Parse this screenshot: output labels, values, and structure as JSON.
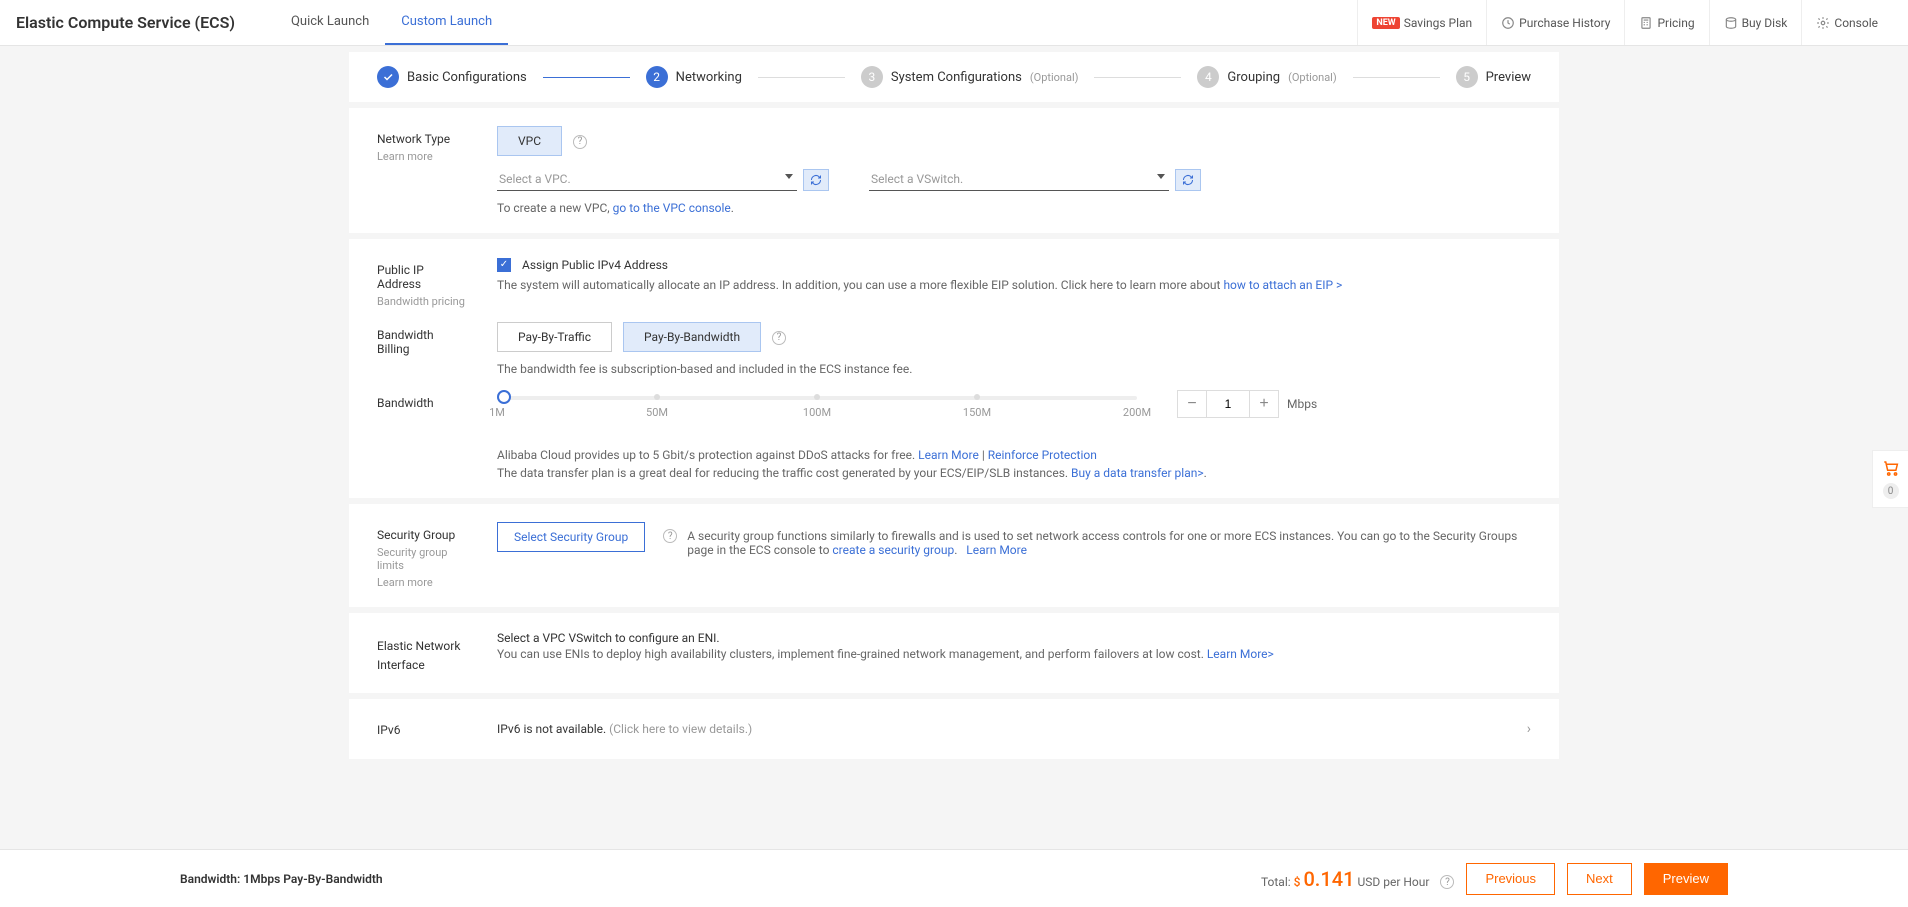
{
  "header": {
    "title": "Elastic Compute Service (ECS)",
    "tabs": {
      "quick": "Quick Launch",
      "custom": "Custom Launch"
    },
    "actions": {
      "new_badge": "NEW",
      "savings": "Savings Plan",
      "history": "Purchase History",
      "pricing": "Pricing",
      "buydisk": "Buy Disk",
      "console": "Console"
    }
  },
  "steps": {
    "s1": "Basic Configurations",
    "s2": "Networking",
    "s3": "System Configurations",
    "s4": "Grouping",
    "s5": "Preview",
    "optional": "(Optional)"
  },
  "network": {
    "label": "Network Type",
    "learn_more": "Learn more",
    "vpc_btn": "VPC",
    "select_vpc_ph": "Select a VPC.",
    "select_vswitch_ph": "Select a VSwitch.",
    "create_note_pre": "To create a new VPC, ",
    "create_note_link": "go to the VPC console"
  },
  "public_ip": {
    "label": "Public IP Address",
    "hint": "Bandwidth pricing",
    "checkbox_label": "Assign Public IPv4 Address",
    "desc_pre": "The system will automatically allocate an IP address. In addition, you can use a more flexible EIP solution. Click here to learn more about ",
    "desc_link": "how to attach an EIP >"
  },
  "billing": {
    "label": "Bandwidth Billing",
    "opt_traffic": "Pay-By-Traffic",
    "opt_bandwidth": "Pay-By-Bandwidth",
    "note": "The bandwidth fee is subscription-based and included in the ECS instance fee."
  },
  "bandwidth": {
    "label": "Bandwidth",
    "ticks": {
      "t1": "1M",
      "t50": "50M",
      "t100": "100M",
      "t150": "150M",
      "t200": "200M"
    },
    "value": "1",
    "unit": "Mbps",
    "ddos_pre": "Alibaba Cloud provides up to 5 Gbit/s protection against DDoS attacks for free.",
    "ddos_learn": "Learn More",
    "ddos_sep": " | ",
    "ddos_reinforce": "Reinforce Protection",
    "dt_pre": "The data transfer plan is a great deal for reducing the traffic cost generated by your ECS/EIP/SLB instances. ",
    "dt_link": "Buy a data transfer plan>"
  },
  "sg": {
    "label": "Security Group",
    "hint1": "Security group limits",
    "hint2": "Learn more",
    "select_btn": "Select Security Group",
    "desc_pre": "A security group functions similarly to firewalls and is used to set network access controls for one or more ECS instances. You can go to the Security Groups page in the ECS console to ",
    "desc_link": "create a security group",
    "learn_more": "Learn More"
  },
  "eni": {
    "label": "Elastic Network Interface",
    "line1": "Select a VPC VSwitch to configure an ENI.",
    "line2_pre": "You can use ENIs to deploy high availability clusters, implement fine-grained network management, and perform failovers at low cost. ",
    "line2_link": "Learn More>"
  },
  "ipv6": {
    "label": "IPv6",
    "text": "IPv6 is not available. ",
    "details": "(Click here to view details.)"
  },
  "footer": {
    "summary_label": "Bandwidth: ",
    "summary_val": "1Mbps Pay-By-Bandwidth",
    "total_label": "Total: ",
    "currency": "$ ",
    "price": "0.141",
    "unit": " USD per Hour",
    "prev": "Previous",
    "next": "Next",
    "preview": "Preview"
  },
  "cart": {
    "count": "0"
  }
}
